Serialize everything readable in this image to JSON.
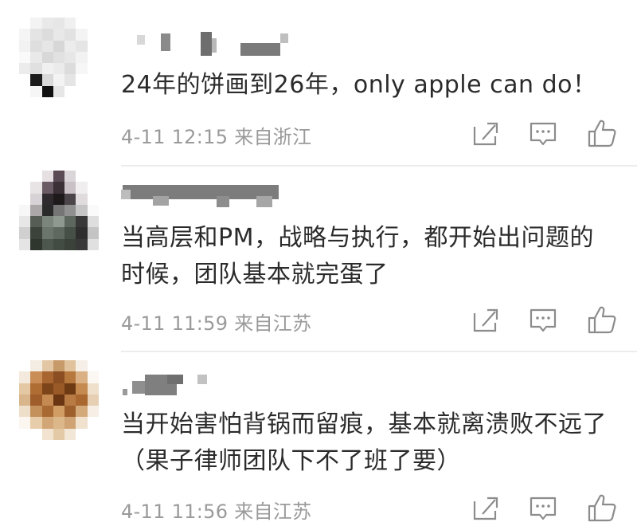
{
  "comments": [
    {
      "username": "",
      "text": "24年的饼画到26年，only apple can do！",
      "time": "4-11 12:15",
      "location": "来自浙江"
    },
    {
      "username": "",
      "text": "当高层和PM，战略与执行，都开始出问题的时候，团队基本就完蛋了",
      "time": "4-11 11:59",
      "location": "来自江苏"
    },
    {
      "username": "",
      "text": "当开始害怕背锅而留痕，基本就离溃败不远了（果子律师团队下不了班了要）",
      "time": "4-11 11:56",
      "location": "来自江苏"
    }
  ],
  "icons": {
    "share": "share-icon",
    "reply": "comment-icon",
    "like": "thumbs-up-icon"
  },
  "colors": {
    "meta_text": "#9a9a9a",
    "body_text": "#2b2b2b",
    "icon_stroke": "#8c8c8c"
  }
}
